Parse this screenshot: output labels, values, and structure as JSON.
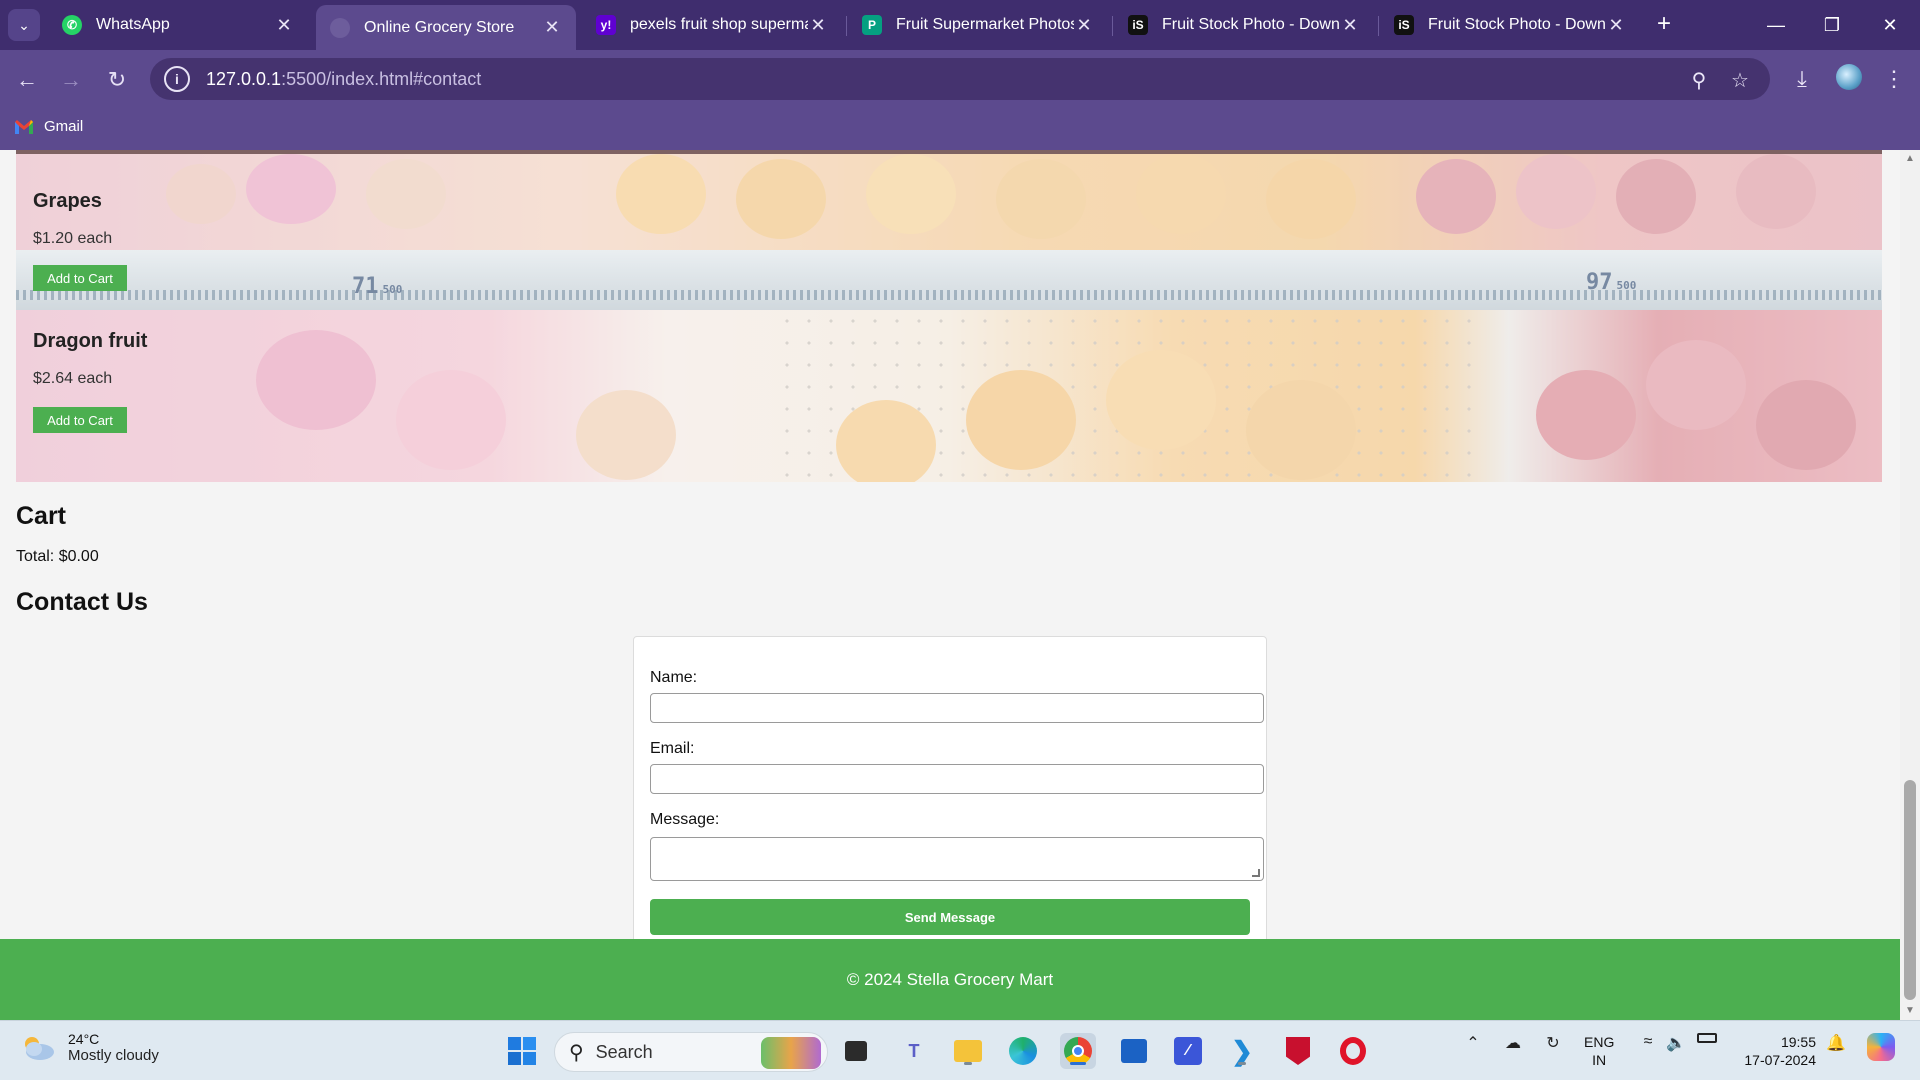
{
  "browser": {
    "tabs": [
      {
        "title": "WhatsApp",
        "icon": "whatsapp-icon",
        "active": false
      },
      {
        "title": "Online Grocery Store",
        "icon": "globe-icon",
        "active": true
      },
      {
        "title": "pexels fruit shop supermar",
        "icon": "yahoo-icon",
        "active": false
      },
      {
        "title": "Fruit Supermarket Photos, ",
        "icon": "pexels-icon",
        "active": false
      },
      {
        "title": "Fruit Stock Photo - Downlo",
        "icon": "istock-icon",
        "active": false
      },
      {
        "title": "Fruit Stock Photo - Downlo",
        "icon": "istock-icon",
        "active": false
      }
    ],
    "url_host": "127.0.0.1",
    "url_rest": ":5500/index.html#contact",
    "bookmarks": [
      {
        "label": "Gmail",
        "icon": "gmail-icon"
      }
    ],
    "accent": "#5c4a8e"
  },
  "products": [
    {
      "name": "Grapes",
      "price": "$1.20 each",
      "button": "Add to Cart"
    },
    {
      "name": "Dragon fruit",
      "price": "$2.64 each",
      "button": "Add to Cart"
    }
  ],
  "shelf_prices": {
    "left": "71",
    "left_small": "500",
    "right": "97",
    "right_small": "500"
  },
  "cart": {
    "heading": "Cart",
    "total": "Total: $0.00"
  },
  "contact": {
    "heading": "Contact Us",
    "name_label": "Name:",
    "email_label": "Email:",
    "message_label": "Message:",
    "name_value": "",
    "email_value": "",
    "message_value": "",
    "submit": "Send Message"
  },
  "footer": {
    "text": "© 2024 Stella Grocery Mart",
    "color": "#4caf50"
  },
  "taskbar": {
    "weather_temp": "24°C",
    "weather_desc": "Mostly cloudy",
    "search_placeholder": "Search",
    "lang_line1": "ENG",
    "lang_line2": "IN",
    "time": "19:55",
    "date": "17-07-2024"
  }
}
